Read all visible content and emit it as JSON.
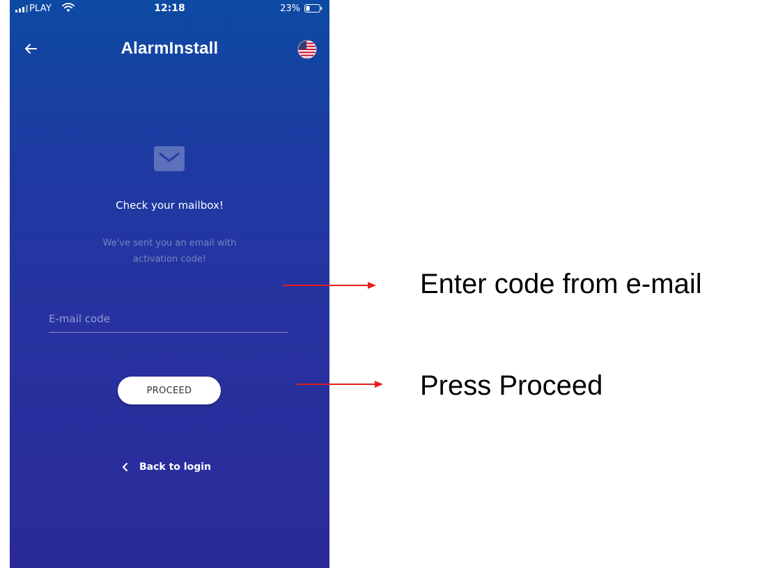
{
  "status_bar": {
    "carrier": "PLAY",
    "time": "12:18",
    "battery": "23%"
  },
  "header": {
    "title": "AlarmInstall",
    "back_icon": "arrow-left-icon",
    "language_icon": "us-flag-icon"
  },
  "content": {
    "icon": "envelope-icon",
    "heading": "Check your mailbox!",
    "subtext": "We've sent you an email with activation code!",
    "code_input": {
      "placeholder": "E-mail code",
      "value": ""
    },
    "proceed_label": "PROCEED",
    "back_to_login_label": "Back to login"
  },
  "annotations": {
    "enter_code": "Enter code from e-mail",
    "press_proceed": "Press Proceed",
    "arrow_color": "#e81c1c"
  },
  "colors": {
    "gradient_top": "#0d4aa3",
    "gradient_bottom": "#2b2a9a"
  }
}
